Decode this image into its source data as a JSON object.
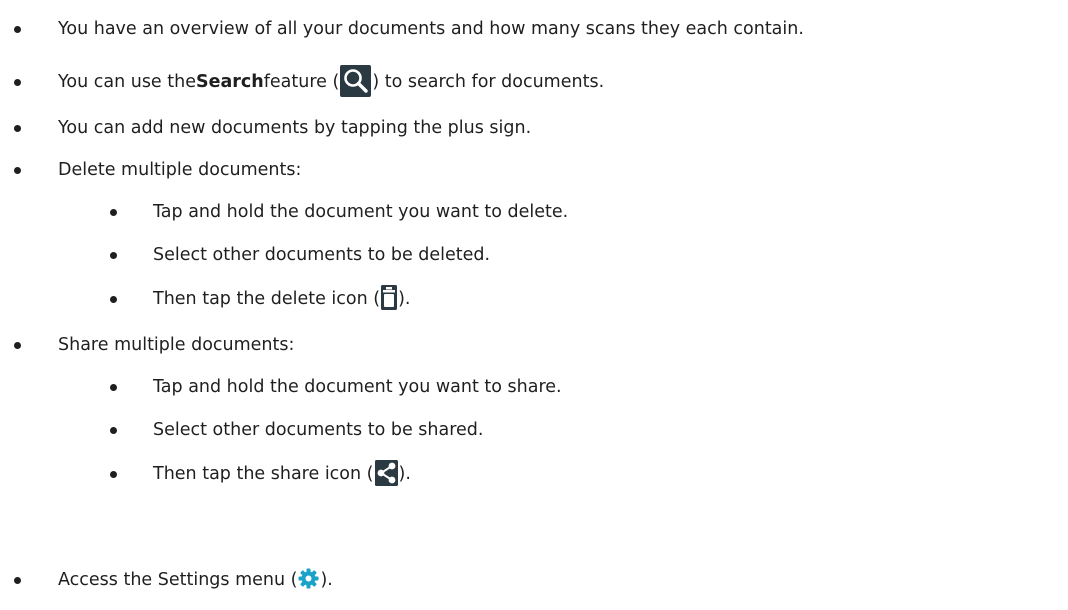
{
  "list": {
    "item1": {
      "text": "You have an overview of all your documents and how many scans they each contain."
    },
    "item2": {
      "pre": "You can use the ",
      "bold": "Search",
      "mid": " feature (",
      "post": ") to search for documents.",
      "icon": "search-icon"
    },
    "item3": {
      "text": "You can add new documents by tapping the plus sign."
    },
    "item4": {
      "text": "Delete multiple documents:",
      "sub": [
        {
          "text": "Tap and hold the document you want to delete."
        },
        {
          "text": "Select other documents to be deleted."
        },
        {
          "pre": "Then tap the delete icon (",
          "post": ").",
          "icon": "trash-icon"
        }
      ]
    },
    "item5": {
      "text": "Share multiple documents:",
      "sub": [
        {
          "text": "Tap and hold the document you want to share."
        },
        {
          "text": "Select other documents to be shared."
        },
        {
          "pre": "Then tap the share icon (",
          "post": ").",
          "icon": "share-icon"
        }
      ]
    },
    "item6": {
      "pre": "Access the Settings menu (",
      "post": ").",
      "icon": "gear-icon"
    }
  },
  "colors": {
    "text": "#1f1f1f",
    "icon_dark_bg": "#2b3a42",
    "icon_glyph": "#ffffff",
    "gear": "#1aa3c8"
  }
}
